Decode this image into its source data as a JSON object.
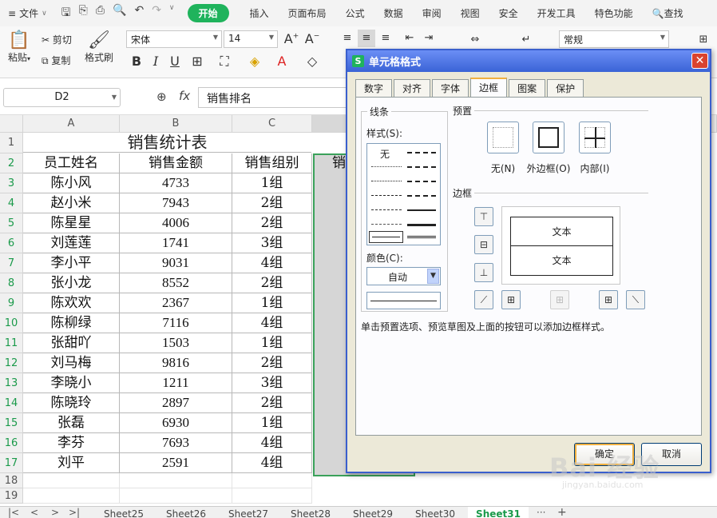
{
  "menubar": {
    "file": "文件",
    "tabs": [
      "插入",
      "页面布局",
      "公式",
      "数据",
      "审阅",
      "视图",
      "安全",
      "开发工具",
      "特色功能",
      "查找"
    ],
    "active_tab": "开始"
  },
  "ribbon": {
    "paste": "粘贴",
    "cut": "剪切",
    "copy": "复制",
    "format_painter": "格式刷",
    "font_name": "宋体",
    "font_size": "14",
    "number_format": "常规"
  },
  "formula_bar": {
    "cell_ref": "D2",
    "formula": "销售排名"
  },
  "sheet": {
    "columns": [
      "A",
      "B",
      "C"
    ],
    "title": "销售统计表",
    "headers": [
      "员工姓名",
      "销售金额",
      "销售组别",
      "销"
    ],
    "row_numbers": [
      "1",
      "2",
      "3",
      "4",
      "5",
      "6",
      "7",
      "8",
      "9",
      "10",
      "11",
      "12",
      "13",
      "14",
      "15",
      "16",
      "17",
      "18",
      "19"
    ],
    "rows": [
      [
        "陈小风",
        "4733",
        "1组"
      ],
      [
        "赵小米",
        "7943",
        "2组"
      ],
      [
        "陈星星",
        "4006",
        "2组"
      ],
      [
        "刘莲莲",
        "1741",
        "3组"
      ],
      [
        "李小平",
        "9031",
        "4组"
      ],
      [
        "张小龙",
        "8552",
        "2组"
      ],
      [
        "陈欢欢",
        "2367",
        "1组"
      ],
      [
        "陈柳绿",
        "7116",
        "4组"
      ],
      [
        "张甜吖",
        "1503",
        "1组"
      ],
      [
        "刘马梅",
        "9816",
        "2组"
      ],
      [
        "李晓小",
        "1211",
        "3组"
      ],
      [
        "陈晓玲",
        "2897",
        "2组"
      ],
      [
        "张磊",
        "6930",
        "1组"
      ],
      [
        "李芬",
        "7693",
        "4组"
      ],
      [
        "刘平",
        "2591",
        "4组"
      ]
    ]
  },
  "sheet_tabs": [
    "Sheet25",
    "Sheet26",
    "Sheet27",
    "Sheet28",
    "Sheet29",
    "Sheet30",
    "Sheet31"
  ],
  "active_sheet": "Sheet31",
  "dialog": {
    "title": "单元格格式",
    "tabs": [
      "数字",
      "对齐",
      "字体",
      "边框",
      "图案",
      "保护"
    ],
    "active_tab": "边框",
    "line_group": "线条",
    "style_label": "样式(S):",
    "style_none": "无",
    "color_label": "颜色(C):",
    "color_value": "自动",
    "preset_group": "预置",
    "presets": [
      "无(N)",
      "外边框(O)",
      "内部(I)"
    ],
    "border_group": "边框",
    "preview_text_top": "文本",
    "preview_text_bottom": "文本",
    "hint": "单击预置选项、预览草图及上面的按钮可以添加边框样式。",
    "ok": "确定",
    "cancel": "取消"
  },
  "watermark": {
    "text": "Bai 经验",
    "sub": "jingyan.baidu.com"
  },
  "colors": {
    "accent_green": "#1fb35c",
    "dialog_title": "#3a63d6",
    "close_red": "#d9432f"
  }
}
